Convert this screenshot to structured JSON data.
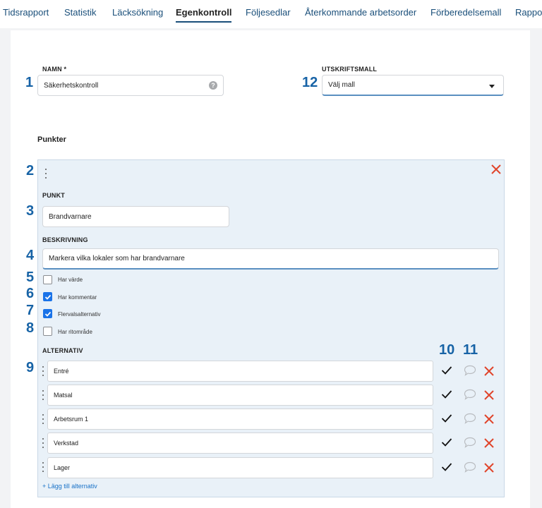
{
  "nav": {
    "tabs": [
      {
        "label": "Tidsrapport",
        "active": false
      },
      {
        "label": "Statistik",
        "active": false
      },
      {
        "label": "Läcksökning",
        "active": false
      },
      {
        "label": "Egenkontroll",
        "active": true
      },
      {
        "label": "Följesedlar",
        "active": false
      },
      {
        "label": "Återkommande arbetsorder",
        "active": false
      },
      {
        "label": "Förberedelsemall",
        "active": false
      },
      {
        "label": "Rapport",
        "active": false
      }
    ]
  },
  "form": {
    "name_label": "NAMN *",
    "name_value": "Säkerhetskontroll",
    "template_label": "UTSKRIFTSMALL",
    "template_value": "Välj mall"
  },
  "points_title": "Punkter",
  "point": {
    "point_label": "PUNKT",
    "point_value": "Brandvarnare",
    "description_label": "BESKRIVNING",
    "description_value": "Markera vilka lokaler som har brandvarnare",
    "options": [
      {
        "label": "Har värde",
        "checked": false
      },
      {
        "label": "Har kommentar",
        "checked": true
      },
      {
        "label": "Flervalsalternativ",
        "checked": true
      },
      {
        "label": "Har ritområde",
        "checked": false
      }
    ],
    "alternatives_label": "ALTERNATIV",
    "alternatives": [
      "Entré",
      "Matsal",
      "Arbetsrum 1",
      "Verkstad",
      "Lager"
    ],
    "add_alternative": "+ Lägg till alternativ"
  },
  "markers": [
    "1",
    "2",
    "3",
    "4",
    "5",
    "6",
    "7",
    "8",
    "9",
    "10",
    "11",
    "12"
  ],
  "colors": {
    "accent": "#1763a6",
    "link": "#1a73c8",
    "delete": "#e0452b",
    "panel_bg": "#e9f1f8",
    "checkbox_checked": "#1a73e8"
  }
}
